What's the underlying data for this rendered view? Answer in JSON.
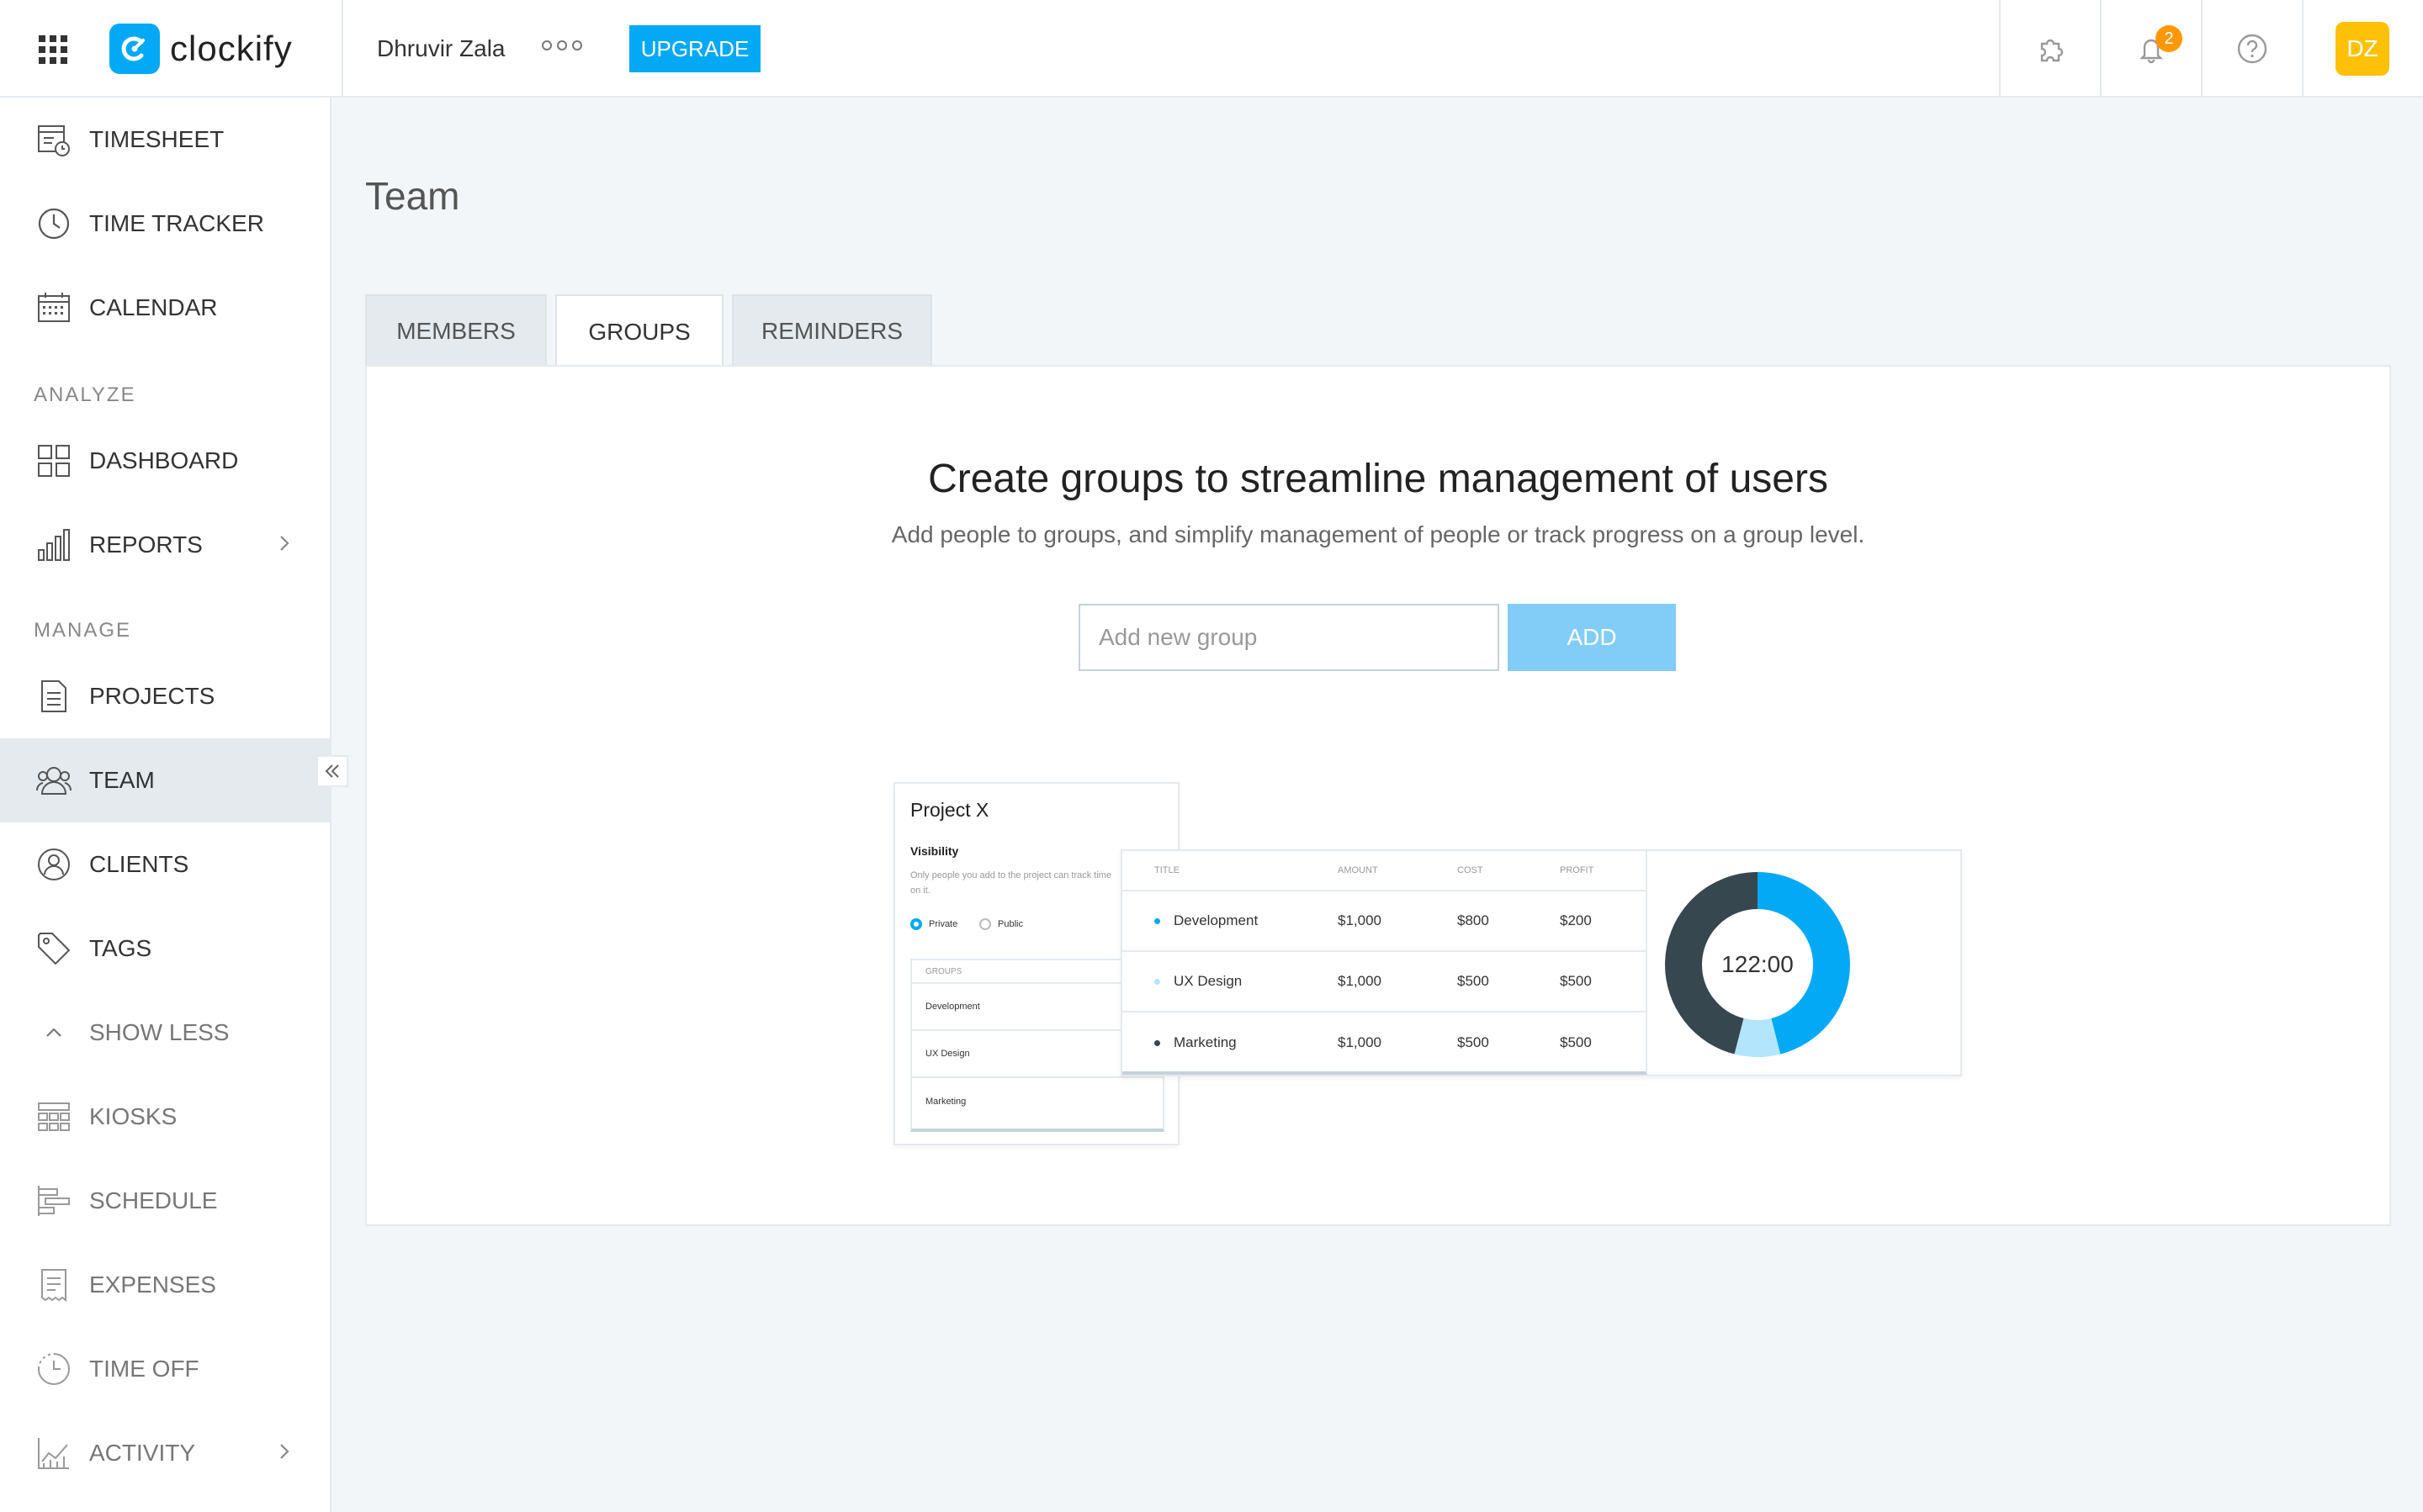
{
  "topbar": {
    "brand": "clockify",
    "user_name": "Dhruvir Zala",
    "upgrade_label": "UPGRADE",
    "notification_count": "2",
    "avatar_initials": "DZ",
    "icons": [
      "apps-grid-icon",
      "more-dots-icon",
      "puzzle-icon",
      "bell-icon",
      "help-icon"
    ]
  },
  "sidebar": {
    "items_top": [
      {
        "label": "TIMESHEET",
        "icon": "timesheet-icon"
      },
      {
        "label": "TIME TRACKER",
        "icon": "clock-icon"
      },
      {
        "label": "CALENDAR",
        "icon": "calendar-icon"
      }
    ],
    "section_analyze": "ANALYZE",
    "items_analyze": [
      {
        "label": "DASHBOARD",
        "icon": "dashboard-icon"
      },
      {
        "label": "REPORTS",
        "icon": "reports-icon"
      }
    ],
    "section_manage": "MANAGE",
    "items_manage": [
      {
        "label": "PROJECTS",
        "icon": "projects-icon"
      },
      {
        "label": "TEAM",
        "icon": "team-icon"
      },
      {
        "label": "CLIENTS",
        "icon": "clients-icon"
      },
      {
        "label": "TAGS",
        "icon": "tag-icon"
      },
      {
        "label": "SHOW LESS",
        "icon": "chevron-up-icon"
      },
      {
        "label": "KIOSKS",
        "icon": "kiosk-icon"
      },
      {
        "label": "SCHEDULE",
        "icon": "schedule-icon"
      },
      {
        "label": "EXPENSES",
        "icon": "receipt-icon"
      },
      {
        "label": "TIME OFF",
        "icon": "time-off-icon"
      },
      {
        "label": "ACTIVITY",
        "icon": "activity-icon"
      }
    ],
    "active_item": "TEAM"
  },
  "main": {
    "page_title": "Team",
    "tabs": [
      {
        "label": "MEMBERS",
        "active": false
      },
      {
        "label": "GROUPS",
        "active": true
      },
      {
        "label": "REMINDERS",
        "active": false
      }
    ],
    "empty_state": {
      "headline": "Create groups to streamline management of users",
      "subline": "Add people to groups, and simplify management of people or track progress on a group level.",
      "input_placeholder": "Add new group",
      "input_value": "",
      "add_label": "ADD"
    },
    "illustration": {
      "project_title": "Project X",
      "visibility_label": "Visibility",
      "visibility_desc": "Only people you add to the project can track time on it.",
      "radio_private": "Private",
      "radio_public": "Public",
      "groups_header": "GROUPS",
      "groups": [
        "Development",
        "UX Design",
        "Marketing"
      ],
      "table_headers": [
        "TITLE",
        "AMOUNT",
        "COST",
        "PROFIT"
      ],
      "table_rows": [
        {
          "title": "Development",
          "amount": "$1,000",
          "cost": "$800",
          "profit": "$200",
          "color": "#03a9f4"
        },
        {
          "title": "UX Design",
          "amount": "$1,000",
          "cost": "$500",
          "profit": "$500",
          "color": "#b3e5fc"
        },
        {
          "title": "Marketing",
          "amount": "$1,000",
          "cost": "$500",
          "profit": "$500",
          "color": "#37474f"
        }
      ],
      "donut_label": "122:00",
      "donut_segments": [
        {
          "name": "Development",
          "fraction": 0.46,
          "color": "#03a9f4"
        },
        {
          "name": "UX Design",
          "fraction": 0.08,
          "color": "#b3e5fc"
        },
        {
          "name": "Marketing",
          "fraction": 0.46,
          "color": "#37474f"
        }
      ]
    }
  },
  "colors": {
    "accent": "#03a9f4",
    "badge": "#ff9800",
    "avatar": "#ffc107",
    "add_button_disabled": "#81cdf7"
  }
}
